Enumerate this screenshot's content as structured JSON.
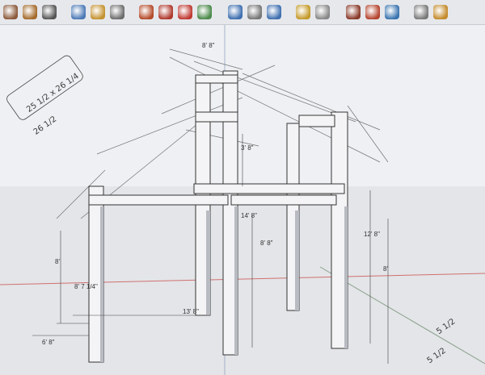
{
  "toolbar": {
    "buttons": [
      {
        "name": "select-tool-icon",
        "color": "#8c5a3b"
      },
      {
        "name": "paint-bucket-icon",
        "color": "#a46b2a"
      },
      {
        "name": "circle-tool-icon",
        "color": "#555555"
      },
      {
        "name": "eraser-icon",
        "color": "#4b79b6"
      },
      {
        "name": "tape-measure-icon",
        "color": "#c4922f"
      },
      {
        "name": "paint-brush-icon",
        "color": "#6d6d6d"
      },
      {
        "name": "push-pull-icon",
        "color": "#b54a2a"
      },
      {
        "name": "move-icon",
        "color": "#b03a2e"
      },
      {
        "name": "rotate-icon",
        "color": "#c03a32"
      },
      {
        "name": "follow-me-icon",
        "color": "#4c8a4a"
      },
      {
        "name": "orbit-icon",
        "color": "#3f6fb0"
      },
      {
        "name": "pan-hand-icon",
        "color": "#777777"
      },
      {
        "name": "zoom-icon",
        "color": "#3f6fb0"
      },
      {
        "name": "zoom-window-icon",
        "color": "#c49b2a"
      },
      {
        "name": "zoom-extents-icon",
        "color": "#888888"
      },
      {
        "name": "walk-icon",
        "color": "#8a3a2a"
      },
      {
        "name": "position-camera-icon",
        "color": "#b5442e"
      },
      {
        "name": "look-around-icon",
        "color": "#3a74b0"
      },
      {
        "name": "3d-warehouse-icon",
        "color": "#7a7a7a"
      },
      {
        "name": "get-models-icon",
        "color": "#c48a2a"
      }
    ]
  },
  "dimensions": {
    "top": "8' 8\"",
    "offset_14": "14' 8\"",
    "center_8_8": "8' 8\"",
    "right_12_8": "12' 8\"",
    "right_8": "8'",
    "left_8": "8'",
    "left_8_7_14": "8' 7 1/4\"",
    "bottom_13": "13' 8\"",
    "bottom_left": "6' 8\"",
    "post_height": "3' 8\""
  },
  "handwriting": {
    "top_left_1": "25 1/2 x 26 1/4",
    "top_left_2": "26 1/2",
    "bottom_right_1": "5 1/2",
    "bottom_right_2": "5 1/2"
  }
}
